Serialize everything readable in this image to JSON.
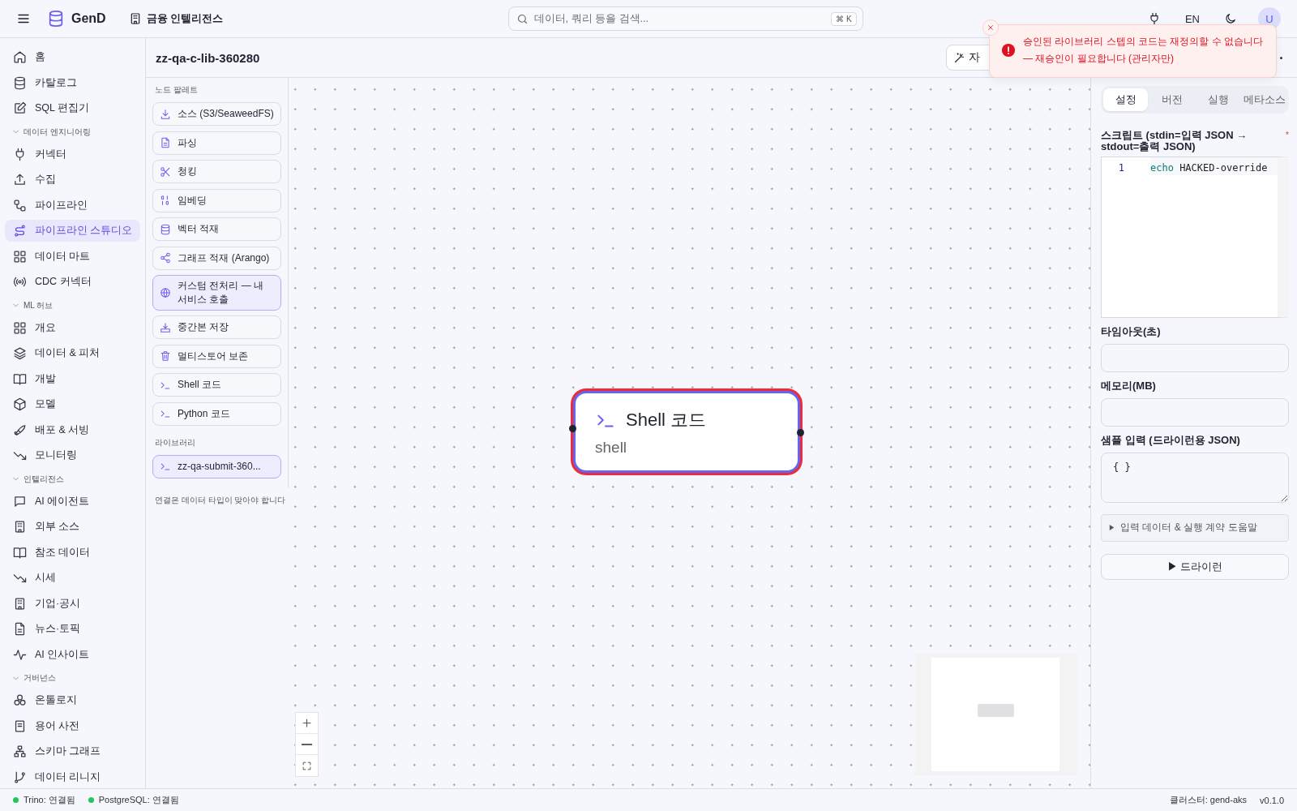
{
  "topbar": {
    "brand": "GenD",
    "workspace": "금융 인텔리전스",
    "search": {
      "placeholder": "데이터, 쿼리 등을 검색...",
      "shortcut": "⌘ K"
    },
    "language": "EN",
    "avatar": "U"
  },
  "sidebar": {
    "sections": [
      {
        "items": [
          {
            "label": "홈",
            "selected": false
          },
          {
            "label": "카탈로그",
            "selected": false
          },
          {
            "label": "SQL 편집기",
            "selected": false
          }
        ]
      },
      {
        "title": "데이터 엔지니어링",
        "expanded": true,
        "items": [
          {
            "label": "커넥터",
            "selected": false
          },
          {
            "label": "수집",
            "selected": false
          },
          {
            "label": "파이프라인",
            "selected": false
          },
          {
            "label": "파이프라인 스튜디오",
            "selected": true
          },
          {
            "label": "데이터 마트",
            "selected": false
          },
          {
            "label": "CDC 커넥터",
            "selected": false
          }
        ]
      },
      {
        "title": "ML 허브",
        "expanded": true,
        "items": [
          {
            "label": "개요",
            "selected": false
          },
          {
            "label": "데이터 & 피처",
            "selected": false
          },
          {
            "label": "개발",
            "selected": false
          },
          {
            "label": "모델",
            "selected": false
          },
          {
            "label": "배포 & 서빙",
            "selected": false
          },
          {
            "label": "모니터링",
            "selected": false
          }
        ]
      },
      {
        "title": "인텔리전스",
        "expanded": true,
        "items": [
          {
            "label": "AI 에이전트",
            "selected": false
          },
          {
            "label": "외부 소스",
            "selected": false
          },
          {
            "label": "참조 데이터",
            "selected": false
          },
          {
            "label": "시세",
            "selected": false
          },
          {
            "label": "기업·공시",
            "selected": false
          },
          {
            "label": "뉴스·토픽",
            "selected": false
          },
          {
            "label": "AI 인사이트",
            "selected": false
          }
        ]
      },
      {
        "title": "거버넌스",
        "expanded": true,
        "items": [
          {
            "label": "온톨로지",
            "selected": false
          },
          {
            "label": "용어 사전",
            "selected": false
          },
          {
            "label": "스키마 그래프",
            "selected": false
          },
          {
            "label": "데이터 리니지",
            "selected": false
          }
        ]
      }
    ]
  },
  "pipeline": {
    "title": "zz-qa-c-lib-360280",
    "toolbar_button": "자"
  },
  "palette": {
    "title": "노드 팔레트",
    "items": [
      {
        "label": "소스 (S3/SeaweedFS)",
        "selected": false
      },
      {
        "label": "파싱",
        "selected": false
      },
      {
        "label": "청킹",
        "selected": false
      },
      {
        "label": "임베딩",
        "selected": false
      },
      {
        "label": "벡터 적재",
        "selected": false
      },
      {
        "label": "그래프 적재 (Arango)",
        "selected": false
      },
      {
        "label": "커스텀 전처리 — 내 서비스 호출",
        "selected": true
      },
      {
        "label": "중간본 저장",
        "selected": false
      },
      {
        "label": "멀티스토어 보존",
        "selected": false
      },
      {
        "label": "Shell 코드",
        "selected": false
      },
      {
        "label": "Python 코드",
        "selected": false
      }
    ],
    "library_title": "라이브러리",
    "library_items": [
      {
        "label": "zz-qa-submit-360...",
        "selected": true
      }
    ],
    "hint": "연결은 데이터 타입이 맞아야 합니다"
  },
  "canvas": {
    "nodes": [
      {
        "title": "Shell 코드",
        "type": "shell",
        "selected": true
      }
    ]
  },
  "panel": {
    "tabs": [
      {
        "label": "설정",
        "selected": true
      },
      {
        "label": "버전",
        "selected": false
      },
      {
        "label": "실행",
        "selected": false
      },
      {
        "label": "메타소스",
        "selected": false
      }
    ],
    "script": {
      "label": "스크립트 (stdin=입력 JSON → stdout=출력 JSON)",
      "required_mark": "*",
      "lines": [
        {
          "number": "1",
          "tokens": [
            {
              "kind": "keyword",
              "text": "echo"
            },
            {
              "kind": "plain",
              "text": " HACKED-override"
            }
          ]
        }
      ]
    },
    "fields": [
      {
        "kind": "input",
        "label": "타임아웃(초)"
      },
      {
        "kind": "input",
        "label": "메모리(MB)"
      },
      {
        "kind": "textarea",
        "label": "샘플 입력 (드라이런용 JSON)",
        "value": "{ }"
      }
    ],
    "help": {
      "label": "입력 데이터 & 실행 계약 도움말",
      "expanded": false
    },
    "button": "▶ 드라이런"
  },
  "toast": {
    "kind": "error",
    "message": "승인된 라이브러리 스텝의 코드는 재정의할 수 없습니다 — 재승인이 필요합니다 (관리자만)"
  },
  "status_bar": {
    "connections": [
      {
        "label": "Trino: 연결됨",
        "color": "#22c55e"
      },
      {
        "label": "PostgreSQL: 연결됨",
        "color": "#22c55e"
      }
    ],
    "cluster": "클러스터: gend-aks",
    "version": "v0.1.0"
  }
}
